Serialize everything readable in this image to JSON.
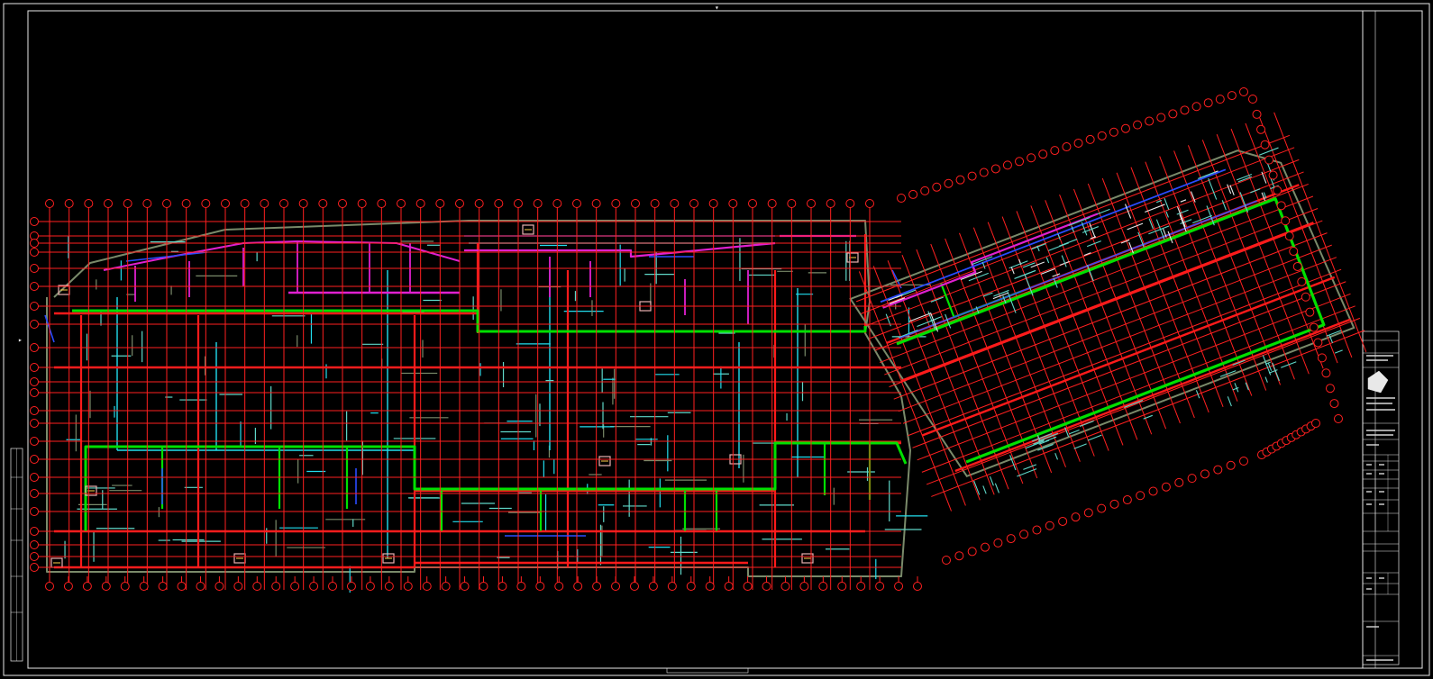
{
  "drawing": {
    "type": "CAD basement / underground floor plan",
    "background": "#000000",
    "colors": {
      "grid_axes": "#ff2020",
      "structure_beams": "#ff1a1a",
      "walls": "#5fd7c8",
      "wall_dark": "#7a8a6a",
      "ducts_cyan": "#22ddee",
      "fire_zone_green": "#00e000",
      "partition_magenta": "#e020d0",
      "blue_lines": "#2a4cff",
      "frame": "#e8e8e8",
      "accent_yellow": "#ffd24a"
    },
    "bottom_axis_count": 47,
    "top_axis_count": 43,
    "right_wing_axis_count": 30
  },
  "title_block": {
    "rows": [
      {
        "label": "",
        "value": ""
      },
      {
        "label": "",
        "value": ""
      },
      {
        "label": "",
        "value": ""
      },
      {
        "label": "",
        "value": ""
      },
      {
        "label": "",
        "value": ""
      }
    ]
  }
}
